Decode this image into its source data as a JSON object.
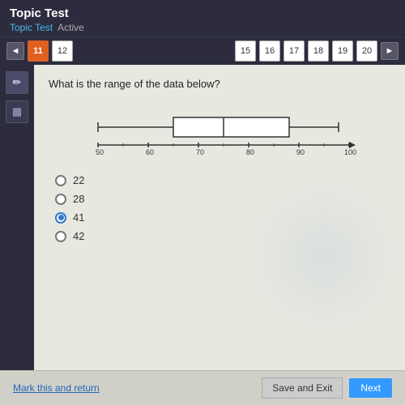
{
  "header": {
    "app_title": "Topic Test",
    "breadcrumb_topic": "Topic Test",
    "breadcrumb_status": "Active"
  },
  "navigation": {
    "prev_arrow": "◄",
    "next_arrow": "►",
    "buttons": [
      {
        "label": "11",
        "active": true
      },
      {
        "label": "12",
        "active": false
      },
      {
        "label": "15",
        "active": false
      },
      {
        "label": "16",
        "active": false
      },
      {
        "label": "17",
        "active": false
      },
      {
        "label": "18",
        "active": false
      },
      {
        "label": "19",
        "active": false
      },
      {
        "label": "20",
        "active": false
      }
    ]
  },
  "sidebar": {
    "icons": [
      {
        "symbol": "✏️",
        "name": "pencil"
      },
      {
        "symbol": "▦",
        "name": "calculator"
      }
    ]
  },
  "question": {
    "text": "What is the range of the data below?",
    "boxplot": {
      "min": 50,
      "q1": 65,
      "median": 75,
      "q3": 88,
      "max": 98,
      "axis_min": 50,
      "axis_max": 100,
      "axis_labels": [
        "50",
        "60",
        "70",
        "80",
        "90",
        "100"
      ]
    },
    "options": [
      {
        "value": "22",
        "selected": false
      },
      {
        "value": "28",
        "selected": false
      },
      {
        "value": "41",
        "selected": true
      },
      {
        "value": "42",
        "selected": false
      }
    ]
  },
  "footer": {
    "mark_return_label": "Mark this and return",
    "save_exit_label": "Save and Exit",
    "next_label": "Next"
  }
}
